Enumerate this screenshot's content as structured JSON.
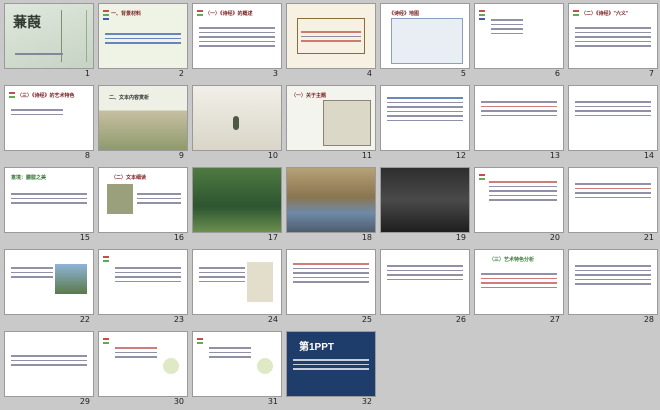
{
  "app": {
    "view": "slide-sorter"
  },
  "slides": [
    {
      "n": "1",
      "title": "蒹葭",
      "kind": "cover"
    },
    {
      "n": "2",
      "title": "一、背景材料",
      "kind": "text-green"
    },
    {
      "n": "3",
      "title": "（一）《诗经》的概述",
      "kind": "text-rule"
    },
    {
      "n": "4",
      "title": "",
      "kind": "diagram"
    },
    {
      "n": "5",
      "title": "《诗经》地图",
      "kind": "map"
    },
    {
      "n": "6",
      "title": "",
      "kind": "bullets"
    },
    {
      "n": "7",
      "title": "（二）《诗经》\"六义\"",
      "kind": "text"
    },
    {
      "n": "8",
      "title": "（三）《诗经》的艺术特色",
      "kind": "text"
    },
    {
      "n": "9",
      "title": "二、文本内容赏析",
      "kind": "reeds"
    },
    {
      "n": "10",
      "title": "",
      "kind": "ink"
    },
    {
      "n": "11",
      "title": "（一）关于主题",
      "kind": "text-scroll"
    },
    {
      "n": "12",
      "title": "",
      "kind": "text"
    },
    {
      "n": "13",
      "title": "",
      "kind": "text"
    },
    {
      "n": "14",
      "title": "",
      "kind": "text"
    },
    {
      "n": "15",
      "title": "意境：朦胧之美",
      "kind": "text-green"
    },
    {
      "n": "16",
      "title": "（二）文本细读",
      "kind": "text-photo"
    },
    {
      "n": "17",
      "title": "",
      "kind": "green-photo"
    },
    {
      "n": "18",
      "title": "",
      "kind": "river-photo"
    },
    {
      "n": "19",
      "title": "",
      "kind": "dark-photo"
    },
    {
      "n": "20",
      "title": "",
      "kind": "text"
    },
    {
      "n": "21",
      "title": "",
      "kind": "text"
    },
    {
      "n": "22",
      "title": "",
      "kind": "text-photo"
    },
    {
      "n": "23",
      "title": "",
      "kind": "text"
    },
    {
      "n": "24",
      "title": "",
      "kind": "text-ink"
    },
    {
      "n": "25",
      "title": "",
      "kind": "text"
    },
    {
      "n": "26",
      "title": "",
      "kind": "text"
    },
    {
      "n": "27",
      "title": "（三）艺术特色分析",
      "kind": "text"
    },
    {
      "n": "28",
      "title": "",
      "kind": "text"
    },
    {
      "n": "29",
      "title": "",
      "kind": "text"
    },
    {
      "n": "30",
      "title": "",
      "kind": "text-bubbles"
    },
    {
      "n": "31",
      "title": "",
      "kind": "text-bubbles"
    },
    {
      "n": "32",
      "title": "第1PPT",
      "kind": "brand"
    }
  ],
  "colors": {
    "accent": "#c0504d",
    "green": "#6aa84f",
    "background": "#c9c9c9"
  }
}
